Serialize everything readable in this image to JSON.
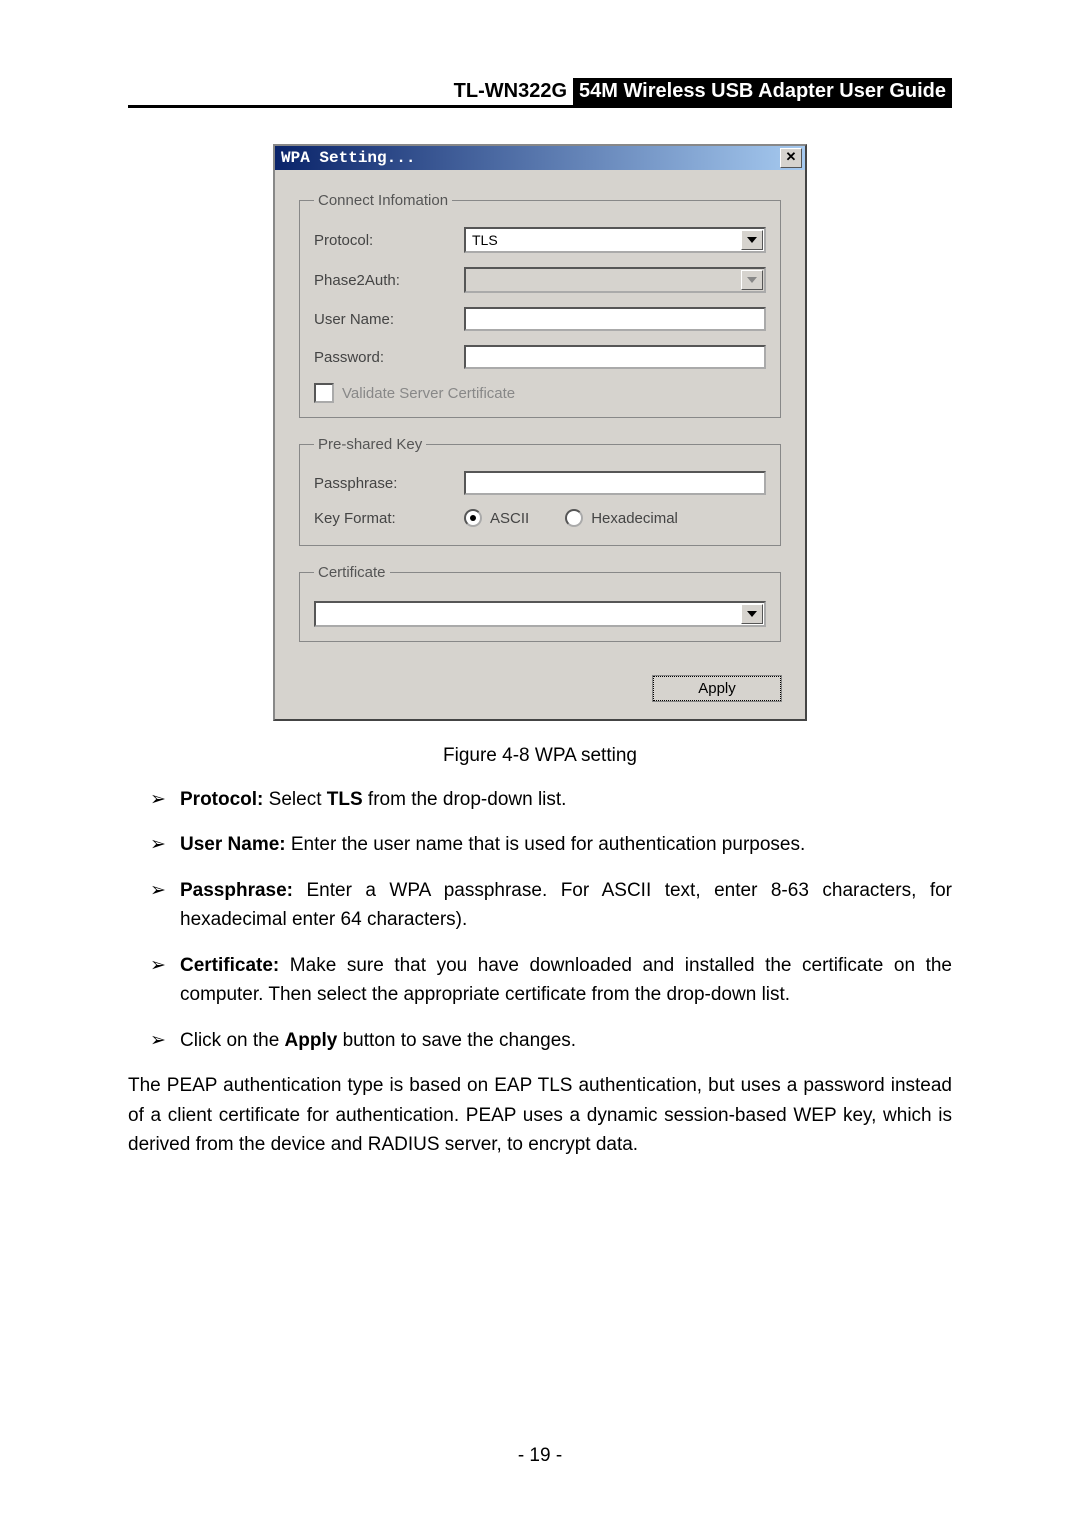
{
  "header": {
    "model": "TL-WN322G",
    "title": "54M Wireless USB Adapter User Guide"
  },
  "dialog": {
    "title": "WPA Setting...",
    "groups": {
      "connect": {
        "legend": "Connect Infomation",
        "protocol_label": "Protocol:",
        "protocol_value": "TLS",
        "phase2_label": "Phase2Auth:",
        "phase2_value": "",
        "username_label": "User Name:",
        "username_value": "",
        "password_label": "Password:",
        "password_value": "",
        "validate_label": "Validate Server Certificate"
      },
      "psk": {
        "legend": "Pre-shared Key",
        "passphrase_label": "Passphrase:",
        "passphrase_value": "",
        "keyformat_label": "Key Format:",
        "radio_ascii": "ASCII",
        "radio_hex": "Hexadecimal"
      },
      "cert": {
        "legend": "Certificate",
        "value": ""
      }
    },
    "apply": "Apply"
  },
  "caption": "Figure 4-8 WPA setting",
  "bullets": [
    {
      "bold": "Protocol:",
      "rest": " Select ",
      "bold2": "TLS",
      "tail": " from the drop-down list."
    },
    {
      "bold": "User Name:",
      "rest": " Enter the user name that is used for authentication purposes."
    },
    {
      "bold": "Passphrase:",
      "rest": " Enter a WPA passphrase. For ASCII text, enter 8-63 characters, for hexadecimal enter 64 characters)."
    },
    {
      "bold": "Certificate:",
      "rest": " Make sure that you have downloaded and installed the certificate on the computer. Then select the appropriate certificate from the drop-down list."
    },
    {
      "plain_pre": "Click on the ",
      "bold": "Apply",
      "plain_post": " button to save the changes."
    }
  ],
  "paragraph": "The PEAP authentication type is based on EAP TLS authentication, but uses a password instead of a client certificate for authentication. PEAP uses a dynamic session-based WEP key, which is derived from the device and RADIUS server, to encrypt data.",
  "footer": "- 19 -"
}
